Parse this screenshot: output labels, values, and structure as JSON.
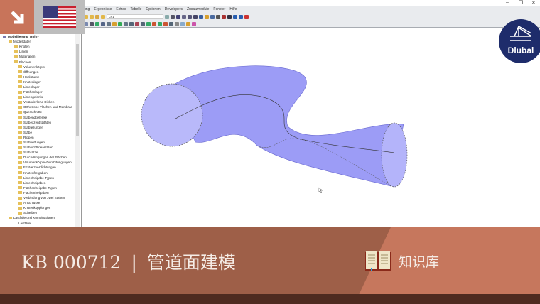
{
  "window": {
    "controls": [
      "–",
      "❐",
      "✕"
    ]
  },
  "menu": [
    "ung",
    "Ergebnisse",
    "Extras",
    "Tabelle",
    "Optionen",
    "Developers",
    "Zusatzmodule",
    "Fenster",
    "Hilfe"
  ],
  "toolbar": {
    "load_case": "LF1"
  },
  "tree": {
    "root": "Modellierung_Rohr*",
    "group": "Modelldaten",
    "items": [
      "Knoten",
      "Linien",
      "Materialien",
      "Flächen",
      "Volumenkörper",
      "Öffnungen",
      "Hohlräume",
      "Knotenlager",
      "Linienlager",
      "Flächenlager",
      "Liniengelenke",
      "Veränderliche Dicken",
      "Orthotrope Flächen und Membran",
      "Querschnitte",
      "Stabendgelenke",
      "Stabexzentrizitäten",
      "Stabteilungen",
      "Stäbe",
      "Rippen",
      "Stabbettungen",
      "Stabnichtlinearitäten",
      "Stabsätze",
      "Durchdringungen der Flächen",
      "Volumenkörper-Durchdringungen",
      "FE-Netzverdichtungen",
      "Knotenfreigaben",
      "Linienfreigabe-Typen",
      "Linienfreigaben",
      "Flächenfreigabe-Typen",
      "Flächenfreigaben",
      "Verbindung von zwei Stäben",
      "Anschlüsse",
      "Knotenkopplungen",
      "Scheiben"
    ],
    "group2": "Lastfälle und Kombinationen",
    "sub2": "Lastfälle"
  },
  "logo": {
    "text": "Dlubal"
  },
  "banner": {
    "kb": "KB 000712",
    "sep": "|",
    "title": "管道面建模",
    "category": "知识库"
  },
  "colors": {
    "accent": "#c8745a",
    "banner": "#9e5f48",
    "pipe": "#8080f0",
    "logo": "#1e2c6b"
  }
}
